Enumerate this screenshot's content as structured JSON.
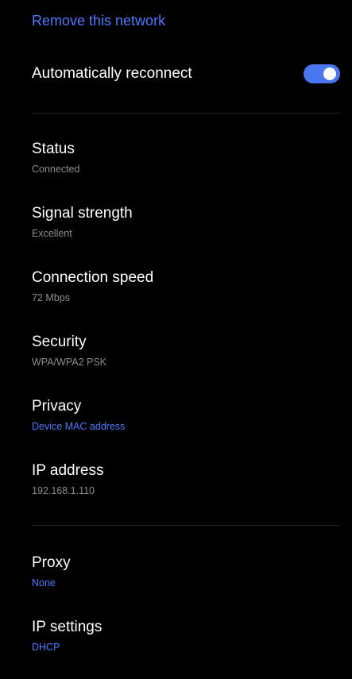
{
  "actions": {
    "remove_network": "Remove this network"
  },
  "auto_reconnect": {
    "label": "Automatically reconnect",
    "enabled": true,
    "on_color": "#4a76f0"
  },
  "details": {
    "status": {
      "title": "Status",
      "value": "Connected"
    },
    "signal_strength": {
      "title": "Signal strength",
      "value": "Excellent"
    },
    "connection_speed": {
      "title": "Connection speed",
      "value": "72 Mbps"
    },
    "security": {
      "title": "Security",
      "value": "WPA/WPA2 PSK"
    },
    "privacy": {
      "title": "Privacy",
      "value": "Device MAC address"
    },
    "ip_address": {
      "title": "IP address",
      "value": "192.168.1.110"
    }
  },
  "advanced": {
    "proxy": {
      "title": "Proxy",
      "value": "None"
    },
    "ip_settings": {
      "title": "IP settings",
      "value": "DHCP"
    }
  },
  "colors": {
    "background": "#000000",
    "accent": "#4d79ff",
    "secondary_text": "#8c8c8c",
    "divider": "#262626"
  }
}
